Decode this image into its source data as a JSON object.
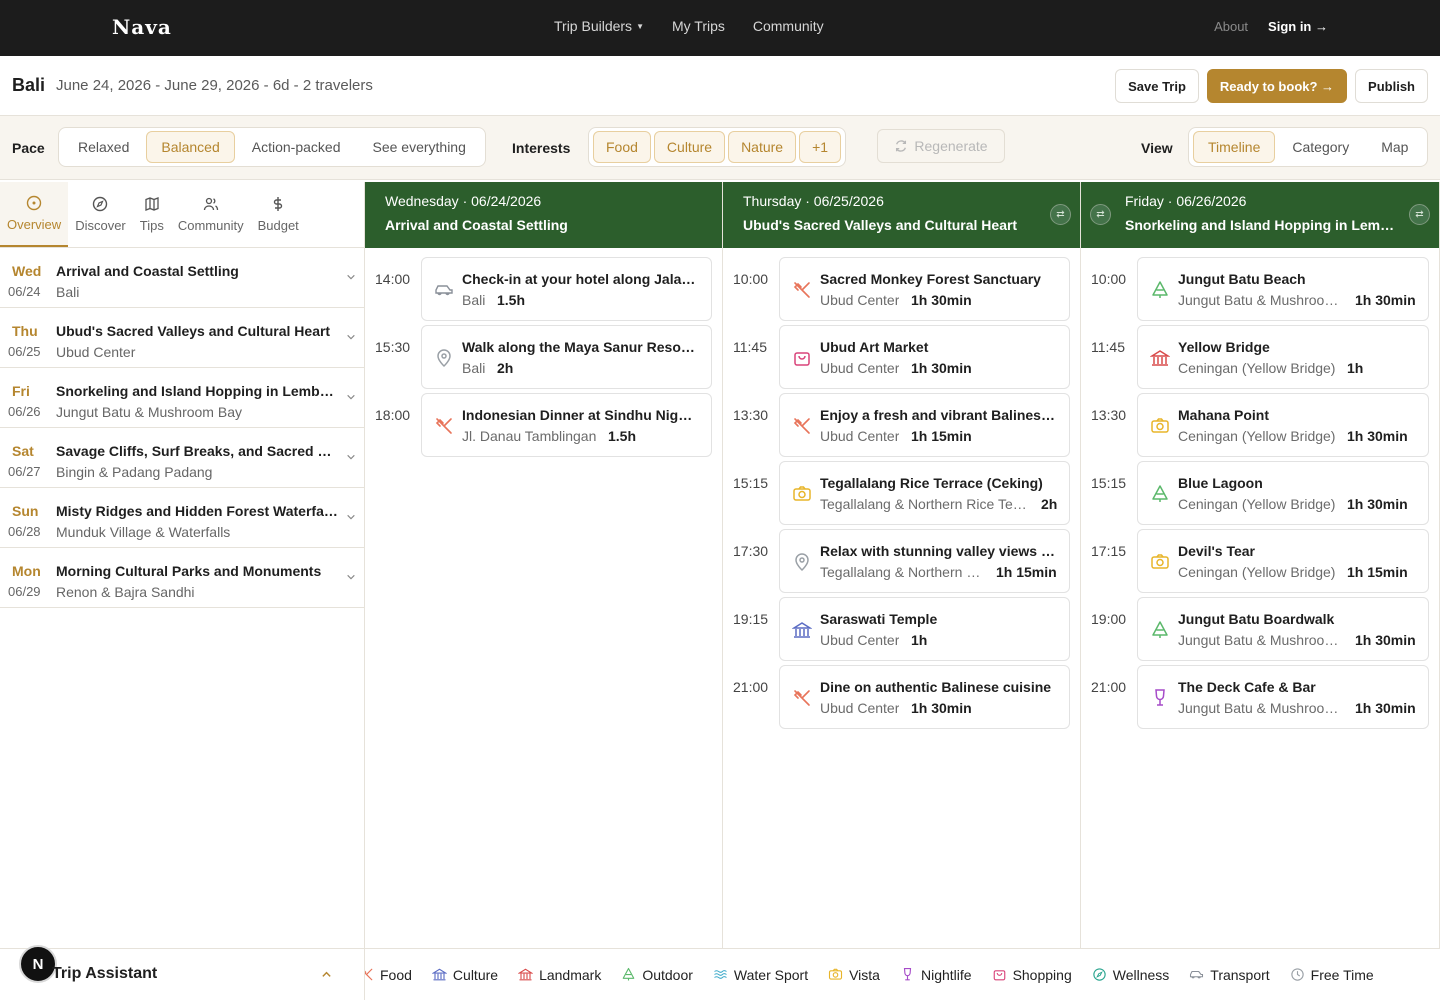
{
  "nav": {
    "brand": "Nava",
    "links": [
      "Trip Builders",
      "My Trips",
      "Community"
    ],
    "about": "About",
    "signin": "Sign in →"
  },
  "trip": {
    "title": "Bali",
    "meta": "June 24, 2026 - June 29, 2026 - 6d - 2 travelers",
    "save": "Save Trip",
    "book": "Ready to book? →",
    "publish": "Publish"
  },
  "filters": {
    "pace_label": "Pace",
    "pace": [
      "Relaxed",
      "Balanced",
      "Action-packed",
      "See everything"
    ],
    "pace_selected": "Balanced",
    "interests_label": "Interests",
    "interests": [
      "Food",
      "Culture",
      "Nature",
      "+1"
    ],
    "regenerate": "Regenerate",
    "view_label": "View",
    "views": [
      "Timeline",
      "Category",
      "Map"
    ],
    "view_selected": "Timeline"
  },
  "sidebar": {
    "tabs": [
      "Overview",
      "Discover",
      "Tips",
      "Community",
      "Budget"
    ],
    "days": [
      {
        "dow": "Wed",
        "date": "06/24",
        "title": "Arrival and Coastal Settling",
        "loc": "Bali"
      },
      {
        "dow": "Thu",
        "date": "06/25",
        "title": "Ubud's Sacred Valleys and Cultural Heart",
        "loc": "Ubud Center"
      },
      {
        "dow": "Fri",
        "date": "06/26",
        "title": "Snorkeling and Island Hopping in Lembongan",
        "loc": "Jungut Batu & Mushroom Bay"
      },
      {
        "dow": "Sat",
        "date": "06/27",
        "title": "Savage Cliffs, Surf Breaks, and Sacred Fires",
        "loc": "Bingin & Padang Padang"
      },
      {
        "dow": "Sun",
        "date": "06/28",
        "title": "Misty Ridges and Hidden Forest Waterfalls",
        "loc": "Munduk Village & Waterfalls"
      },
      {
        "dow": "Mon",
        "date": "06/29",
        "title": "Morning Cultural Parks and Monuments",
        "loc": "Renon & Bajra Sandhi"
      }
    ],
    "assistant": "Trip Assistant",
    "avatar": "N"
  },
  "columns": [
    {
      "date": "Wednesday · 06/24/2026",
      "title": "Arrival and Coastal Settling",
      "activities": [
        {
          "time": "14:00",
          "name": "Check-in at your hotel along Jalan Danau Tamblingan",
          "loc": "Bali",
          "dur": "1.5h",
          "icon": "transport-icon"
        },
        {
          "time": "15:30",
          "name": "Walk along the Maya Sanur Resort beachfront",
          "loc": "Bali",
          "dur": "2h",
          "icon": "pin-icon"
        },
        {
          "time": "18:00",
          "name": "Indonesian Dinner at Sindhu Night Market",
          "loc": "Jl. Danau Tamblingan",
          "dur": "1.5h",
          "icon": "food-icon"
        }
      ]
    },
    {
      "date": "Thursday · 06/25/2026",
      "title": "Ubud's Sacred Valleys and Cultural Heart",
      "activities": [
        {
          "time": "10:00",
          "name": "Sacred Monkey Forest Sanctuary",
          "loc": "Ubud Center",
          "dur": "1h 30min",
          "icon": "food-icon"
        },
        {
          "time": "11:45",
          "name": "Ubud Art Market",
          "loc": "Ubud Center",
          "dur": "1h 30min",
          "icon": "shopping-icon"
        },
        {
          "time": "13:30",
          "name": "Enjoy a fresh and vibrant Balinese lunch",
          "loc": "Ubud Center",
          "dur": "1h 15min",
          "icon": "food-icon"
        },
        {
          "time": "15:15",
          "name": "Tegallalang Rice Terrace (Ceking)",
          "loc": "Tegallalang & Northern Rice Terraces",
          "dur": "2h",
          "icon": "vista-icon"
        },
        {
          "time": "17:30",
          "name": "Relax with stunning valley views at sunset",
          "loc": "Tegallalang & Northern Rice Terraces",
          "dur": "1h 15min",
          "icon": "pin-icon"
        },
        {
          "time": "19:15",
          "name": "Saraswati Temple",
          "loc": "Ubud Center",
          "dur": "1h",
          "icon": "culture-icon"
        },
        {
          "time": "21:00",
          "name": "Dine on authentic Balinese cuisine",
          "loc": "Ubud Center",
          "dur": "1h 30min",
          "icon": "food-icon"
        }
      ]
    },
    {
      "date": "Friday · 06/26/2026",
      "title": "Snorkeling and Island Hopping in Lembongan",
      "activities": [
        {
          "time": "10:00",
          "name": "Jungut Batu Beach",
          "loc": "Jungut Batu & Mushroom Bay",
          "dur": "1h 30min",
          "icon": "outdoor-icon"
        },
        {
          "time": "11:45",
          "name": "Yellow Bridge",
          "loc": "Ceningan (Yellow Bridge)",
          "dur": "1h",
          "icon": "landmark-icon"
        },
        {
          "time": "13:30",
          "name": "Mahana Point",
          "loc": "Ceningan (Yellow Bridge)",
          "dur": "1h 30min",
          "icon": "vista-icon"
        },
        {
          "time": "15:15",
          "name": "Blue Lagoon",
          "loc": "Ceningan (Yellow Bridge)",
          "dur": "1h 30min",
          "icon": "outdoor-icon"
        },
        {
          "time": "17:15",
          "name": "Devil's Tear",
          "loc": "Ceningan (Yellow Bridge)",
          "dur": "1h 15min",
          "icon": "vista-icon"
        },
        {
          "time": "19:00",
          "name": "Jungut Batu Boardwalk",
          "loc": "Jungut Batu & Mushroom Bay",
          "dur": "1h 30min",
          "icon": "outdoor-icon"
        },
        {
          "time": "21:00",
          "name": "The Deck Cafe & Bar",
          "loc": "Jungut Batu & Mushroom Bay",
          "dur": "1h 30min",
          "icon": "nightlife-icon"
        }
      ]
    }
  ],
  "legend": [
    "Food",
    "Culture",
    "Landmark",
    "Outdoor",
    "Water Sport",
    "Vista",
    "Nightlife",
    "Shopping",
    "Wellness",
    "Transport",
    "Free Time"
  ],
  "colors": {
    "accent": "#b5862f",
    "header_green": "#2c5e2c",
    "food": "#e8745a",
    "culture": "#5b6cc4",
    "landmark": "#d94b4b",
    "outdoor": "#5bb86b",
    "water": "#3aa9c9",
    "vista": "#e8b52a",
    "nightlife": "#a64bc9",
    "shopping": "#d9437a",
    "wellness": "#2aa58f",
    "transport": "#8a9099",
    "pin": "#9aa0a6"
  }
}
